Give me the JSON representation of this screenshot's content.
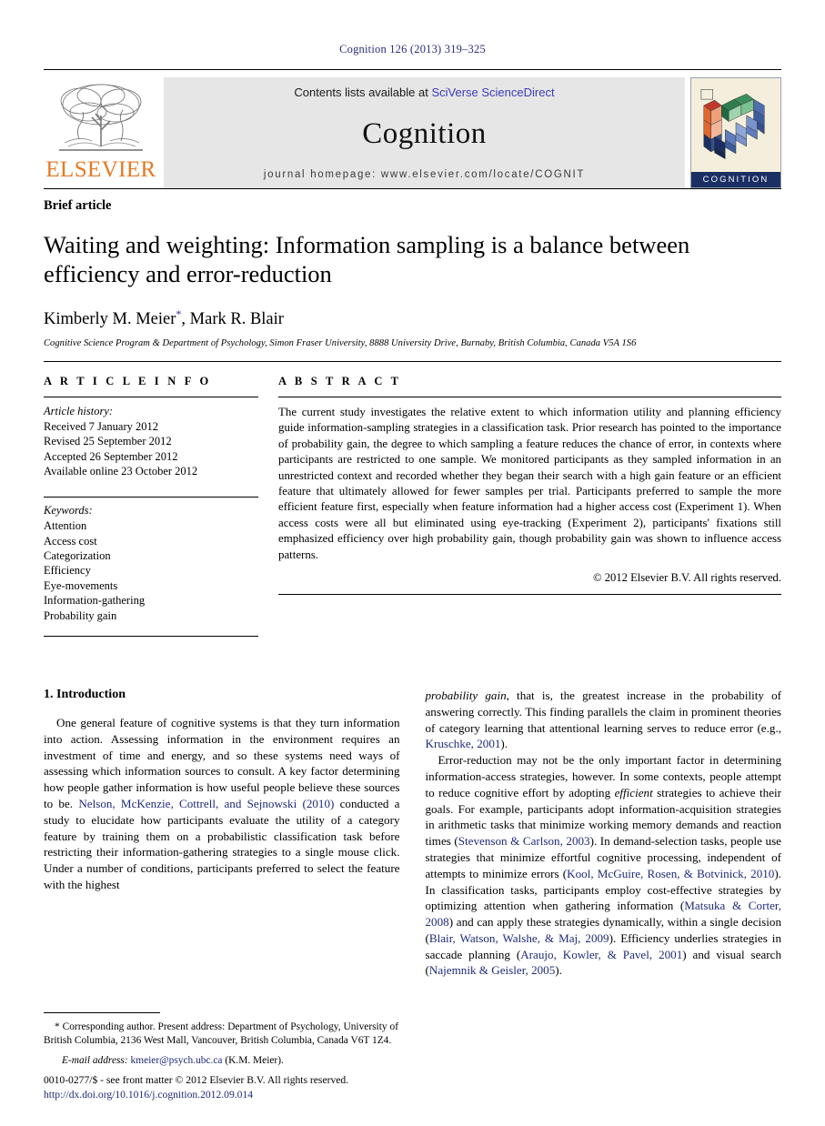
{
  "running_head": "Cognition 126 (2013) 319–325",
  "masthead": {
    "contents_prefix": "Contents lists available at ",
    "contents_link": "SciVerse ScienceDirect",
    "journal_name": "Cognition",
    "homepage": "journal homepage: www.elsevier.com/locate/COGNIT",
    "publisher_wordmark": "ELSEVIER",
    "cover_band_label": "COGNITION",
    "link_color": "#3b3bbd",
    "wordmark_color": "#E87722"
  },
  "article": {
    "type_label": "Brief article",
    "title": "Waiting and weighting: Information sampling is a balance between efficiency and error-reduction",
    "authors": "Kimberly M. Meier",
    "author_marker": "*",
    "authors_rest": ", Mark R. Blair",
    "affiliation": "Cognitive Science Program & Department of Psychology, Simon Fraser University, 8888 University Drive, Burnaby, British Columbia, Canada V5A 1S6"
  },
  "info": {
    "heading": "A R T I C L E   I N F O",
    "history_title": "Article history:",
    "history": [
      "Received 7 January 2012",
      "Revised 25 September 2012",
      "Accepted 26 September 2012",
      "Available online 23 October 2012"
    ],
    "keywords_title": "Keywords:",
    "keywords": [
      "Attention",
      "Access cost",
      "Categorization",
      "Efficiency",
      "Eye-movements",
      "Information-gathering",
      "Probability gain"
    ]
  },
  "abstract": {
    "heading": "A B S T R A C T",
    "text": "The current study investigates the relative extent to which information utility and planning efficiency guide information-sampling strategies in a classification task. Prior research has pointed to the importance of probability gain, the degree to which sampling a feature reduces the chance of error, in contexts where participants are restricted to one sample. We monitored participants as they sampled information in an unrestricted context and recorded whether they began their search with a high gain feature or an efficient feature that ultimately allowed for fewer samples per trial. Participants preferred to sample the more efficient feature first, especially when feature information had a higher access cost (Experiment 1). When access costs were all but eliminated using eye-tracking (Experiment 2), participants' fixations still emphasized efficiency over high probability gain, though probability gain was shown to influence access patterns.",
    "copyright": "© 2012 Elsevier B.V. All rights reserved."
  },
  "body": {
    "section_heading": "1. Introduction",
    "left_para_1_a": "One general feature of cognitive systems is that they turn information into action. Assessing information in the environment requires an investment of time and energy, and so these systems need ways of assessing which information sources to consult. A key factor determining how people gather information is how useful people believe these sources to be. ",
    "left_cite_1": "Nelson, McKenzie, Cottrell, and Sejnowski (2010)",
    "left_para_1_b": " conducted a study to elucidate how participants evaluate the utility of a category feature by training them on a probabilistic classification task before restricting their information-gathering strategies to a single mouse click. Under a number of conditions, participants preferred to select the feature with the highest ",
    "right_italic_lead": "probability gain",
    "right_para_1_a": ", that is, the greatest increase in the probability of answering correctly. This finding parallels the claim in prominent theories of category learning that attentional learning serves to reduce error (e.g., ",
    "right_cite_1": "Kruschke, 2001",
    "right_para_1_b": ").",
    "right_para_2_a": "Error-reduction may not be the only important factor in determining information-access strategies, however. In some contexts, people attempt to reduce cognitive effort by adopting ",
    "right_italic_efficient": "efficient",
    "right_para_2_b": " strategies to achieve their goals. For example, participants adopt information-acquisition strategies in arithmetic tasks that minimize working memory demands and reaction times (",
    "right_cite_2": "Stevenson & Carlson, 2003",
    "right_para_2_c": "). In demand-selection tasks, people use strategies that minimize effortful cognitive processing, independent of attempts to minimize errors (",
    "right_cite_3": "Kool, McGuire, Rosen, & Botvinick, 2010",
    "right_para_2_d": "). In classification tasks, participants employ cost-effective strategies by optimizing attention when gathering information (",
    "right_cite_4": "Matsuka & Corter, 2008",
    "right_para_2_e": ") and can apply these strategies dynamically, within a single decision (",
    "right_cite_5": "Blair, Watson, Walshe, & Maj, 2009",
    "right_para_2_f": "). Efficiency underlies strategies in saccade planning (",
    "right_cite_6": "Araujo, Kowler, & Pavel, 2001",
    "right_para_2_g": ") and visual search (",
    "right_cite_7": "Najemnik & Geisler, 2005",
    "right_para_2_h": ")."
  },
  "footnote": {
    "marker": "*",
    "text": " Corresponding author. Present address: Department of Psychology, University of British Columbia, 2136 West Mall, Vancouver, British Columbia, Canada V6T 1Z4.",
    "email_label": "E-mail address:",
    "email": "kmeier@psych.ubc.ca",
    "email_owner": " (K.M. Meier)."
  },
  "footer": {
    "front_matter": "0010-0277/$ - see front matter © 2012 Elsevier B.V. All rights reserved.",
    "doi": "http://dx.doi.org/10.1016/j.cognition.2012.09.014"
  }
}
